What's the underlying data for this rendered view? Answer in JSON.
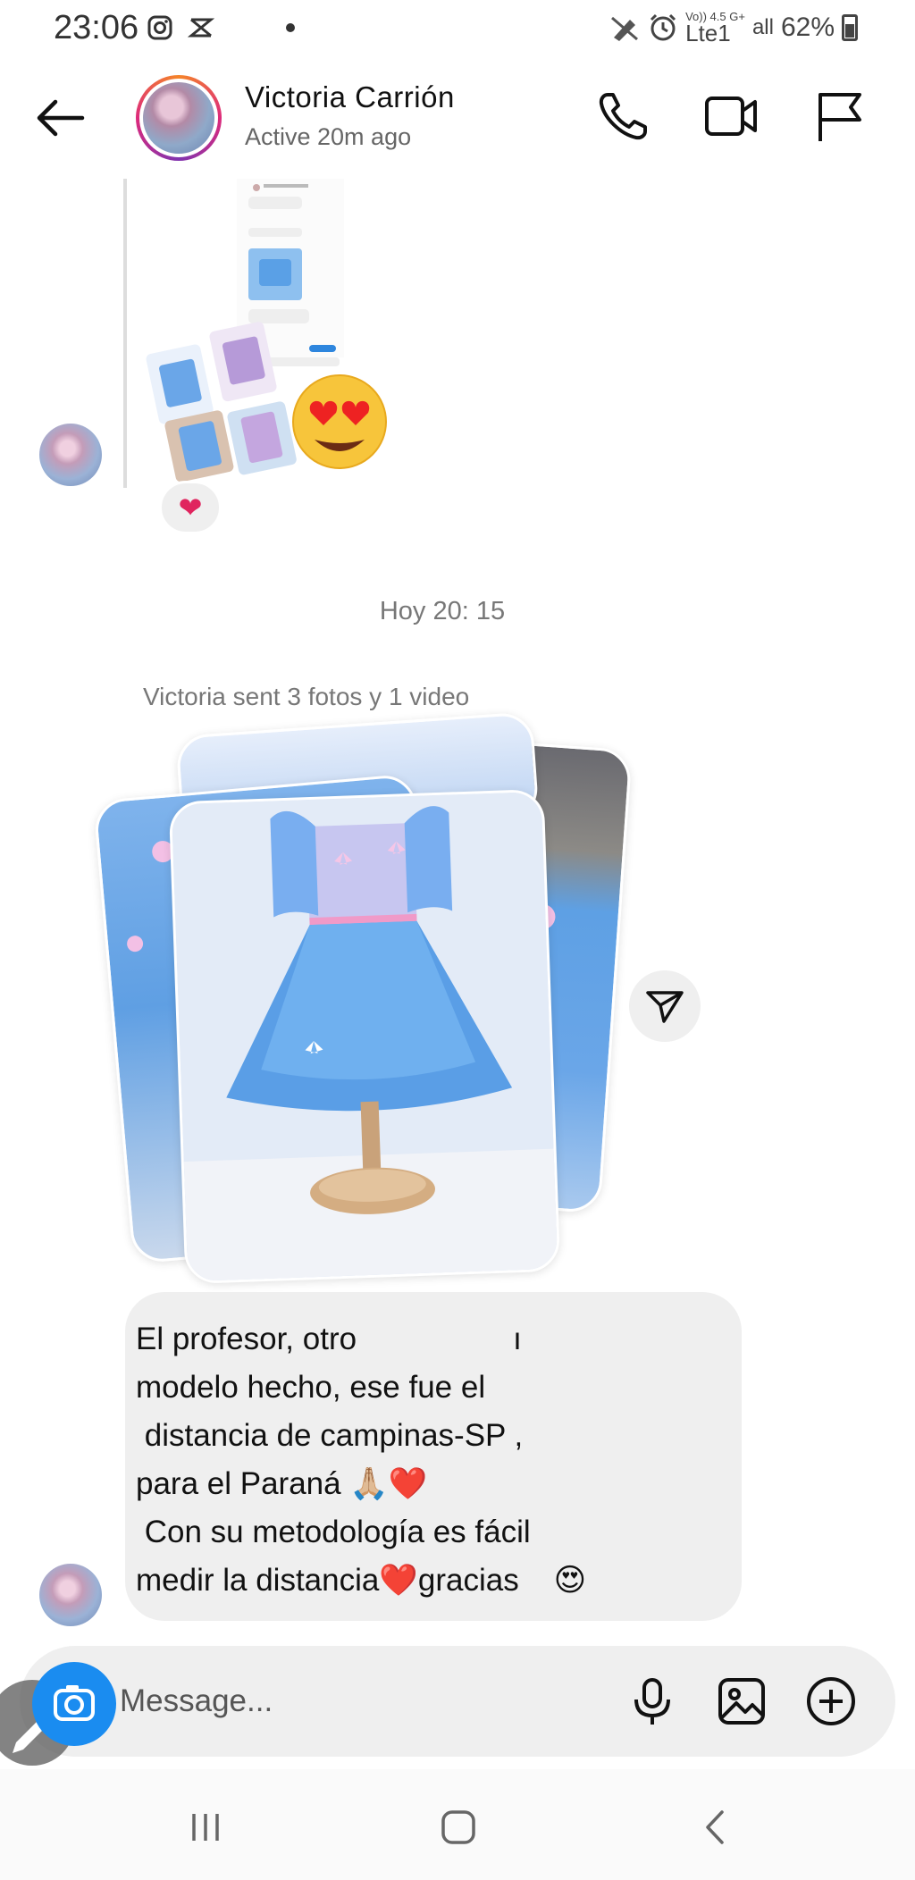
{
  "status_bar": {
    "time": "23:06",
    "right_small_line1": "Vo)) 4.5 G+",
    "right_small_line2": "Lte1",
    "signal": "all",
    "battery": "62%"
  },
  "header": {
    "contact_name": "Victoria Carrión",
    "status": "Active 20m ago"
  },
  "thread": {
    "reaction": "❤",
    "timestamp": "Hoy 20: 15",
    "sent_note": "Victoria sent 3 fotos y 1 video",
    "message_lines": [
      "El profesor, otro                  ı",
      "modelo hecho, ese fue el",
      " distancia de campinas-SP ,",
      "para el Paraná 🙏🏼❤️",
      " Con su metodología es fácil",
      "medir la distancia❤️gracias    😍"
    ]
  },
  "composer": {
    "placeholder": "Message..."
  },
  "colors": {
    "accent_blue": "#1a8cf0",
    "bubble_bg": "#efefef",
    "dress_blue": "#6aa6e8"
  }
}
